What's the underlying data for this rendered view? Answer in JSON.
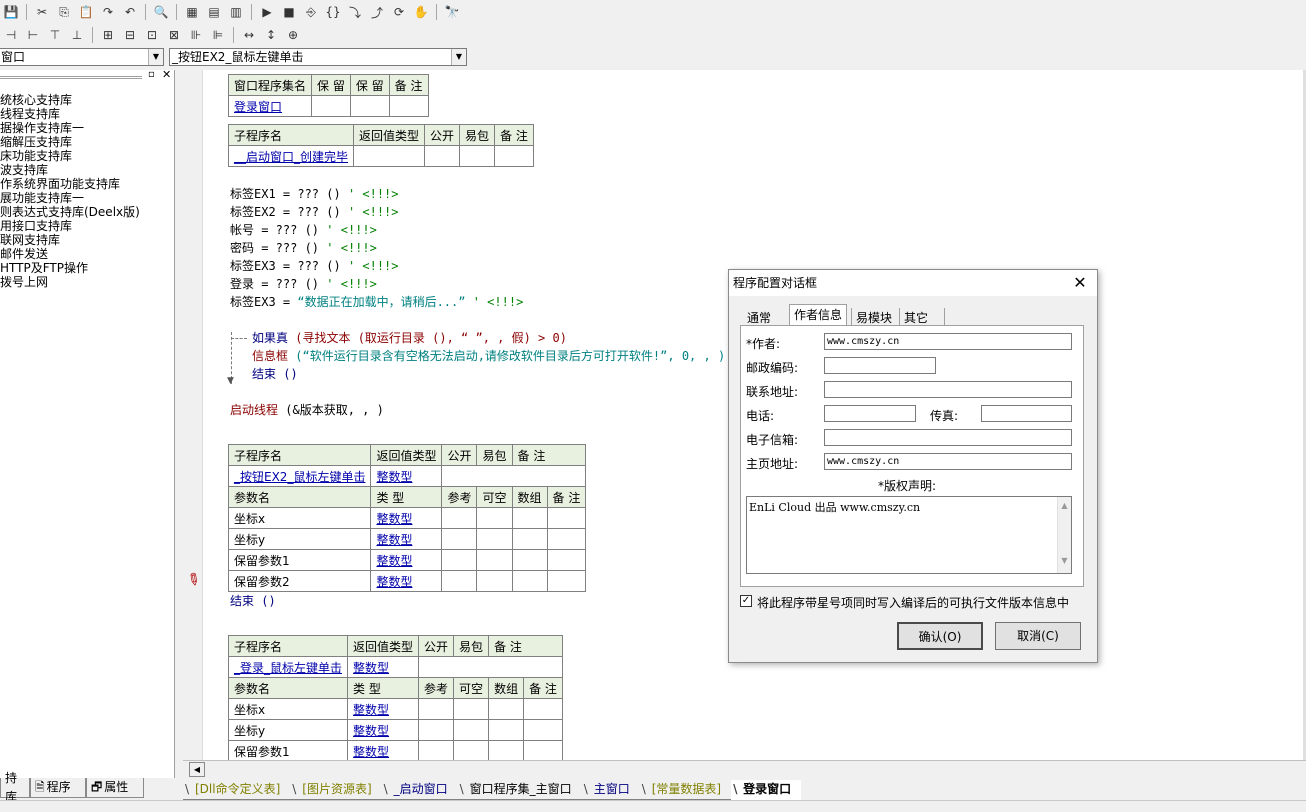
{
  "toolbar1": [
    {
      "name": "save-icon",
      "glyph": "💾"
    },
    {
      "name": "cut-icon",
      "glyph": "✂"
    },
    {
      "name": "copy-icon",
      "glyph": "⎘"
    },
    {
      "name": "paste-icon",
      "glyph": "📋"
    },
    {
      "name": "redo-icon",
      "glyph": "↷"
    },
    {
      "name": "undo-icon",
      "glyph": "↶"
    },
    {
      "name": "find-icon",
      "glyph": "🔍"
    },
    {
      "name": "layout1-icon",
      "glyph": "▦"
    },
    {
      "name": "layout2-icon",
      "glyph": "▤"
    },
    {
      "name": "layout3-icon",
      "glyph": "▥"
    },
    {
      "name": "run-icon",
      "glyph": "▶"
    },
    {
      "name": "stop-icon",
      "glyph": "■"
    },
    {
      "name": "step1-icon",
      "glyph": "⎆"
    },
    {
      "name": "step2-icon",
      "glyph": "{}"
    },
    {
      "name": "step3-icon",
      "glyph": "⤵"
    },
    {
      "name": "step4-icon",
      "glyph": "⤴"
    },
    {
      "name": "step5-icon",
      "glyph": "⟳"
    },
    {
      "name": "hand-icon",
      "glyph": "✋"
    },
    {
      "name": "binoculars-icon",
      "glyph": "🔭"
    }
  ],
  "toolbar2": [
    {
      "name": "align1-icon",
      "glyph": "⊣"
    },
    {
      "name": "align2-icon",
      "glyph": "⊢"
    },
    {
      "name": "align3-icon",
      "glyph": "⊤"
    },
    {
      "name": "align4-icon",
      "glyph": "⊥"
    },
    {
      "name": "align5-icon",
      "glyph": "⊞"
    },
    {
      "name": "align6-icon",
      "glyph": "⊟"
    },
    {
      "name": "align7-icon",
      "glyph": "⊡"
    },
    {
      "name": "align8-icon",
      "glyph": "⊠"
    },
    {
      "name": "align9-icon",
      "glyph": "⊪"
    },
    {
      "name": "align10-icon",
      "glyph": "⊫"
    },
    {
      "name": "size1-icon",
      "glyph": "↔"
    },
    {
      "name": "size2-icon",
      "glyph": "↕"
    },
    {
      "name": "size3-icon",
      "glyph": "⊕"
    }
  ],
  "combo_left": "窗口",
  "combo_right": "_按钮EX2_鼠标左键单击",
  "libraries": [
    "统核心支持库",
    "线程支持库",
    "据操作支持库一",
    "缩解压支持库",
    "床功能支持库",
    "波支持库",
    "作系统界面功能支持库",
    "展功能支持库一",
    "则表达式支持库(Deelx版)",
    "用接口支持库",
    "联网支持库",
    "  邮件发送",
    "  HTTP及FTP操作",
    "  拨号上网"
  ],
  "left_tabs": {
    "lib": "持库",
    "program": "程序",
    "props": "属性"
  },
  "table_set": {
    "headers": [
      "窗口程序集名",
      "保 留",
      "保 留",
      "备 注"
    ],
    "row": [
      "登录窗口",
      "",
      "",
      ""
    ]
  },
  "table_sub1": {
    "headers": [
      "子程序名",
      "返回值类型",
      "公开",
      "易包",
      "备 注"
    ],
    "row": [
      "__启动窗口_创建完毕",
      "",
      "",
      "",
      ""
    ]
  },
  "code1": [
    {
      "lhs": "标签EX1 = ??? ()",
      "cm": "' <!!!>"
    },
    {
      "lhs": "标签EX2 = ??? ()",
      "cm": "' <!!!>"
    },
    {
      "lhs": "帐号 = ??? ()",
      "cm": "' <!!!>"
    },
    {
      "lhs": "密码 = ??? ()",
      "cm": "' <!!!>"
    },
    {
      "lhs": "标签EX3 = ??? ()",
      "cm": "' <!!!>"
    },
    {
      "lhs": "登录 = ??? ()",
      "cm": "' <!!!>"
    }
  ],
  "code1_last": {
    "lhs": "标签EX3 = ",
    "str": "“数据正在加载中，请稍后...”",
    "cm": "' <!!!>"
  },
  "if_line": {
    "kw": "如果真",
    "rest": " (寻找文本 (取运行目录 (), “ ”, , 假) > 0)"
  },
  "msg_line": {
    "kw": "信息框",
    "str": " (“软件运行目录含有空格无法启动,请修改软件目录后方可打开软件!”, 0, , )"
  },
  "end_line1": "结束 ()",
  "thread_line": {
    "kw": "启动线程",
    "rest": " (&版本获取, , )"
  },
  "table_sub2": {
    "headers": [
      "子程序名",
      "返回值类型",
      "公开",
      "易包",
      "备 注"
    ],
    "row": [
      "_按钮EX2_鼠标左键单击",
      "整数型"
    ],
    "param_headers": [
      "参数名",
      "类 型",
      "参考",
      "可空",
      "数组",
      "备 注"
    ],
    "params": [
      [
        "坐标x",
        "整数型"
      ],
      [
        "坐标y",
        "整数型"
      ],
      [
        "保留参数1",
        "整数型"
      ],
      [
        "保留参数2",
        "整数型"
      ]
    ]
  },
  "end_line2": "结束 ()",
  "table_sub3": {
    "headers": [
      "子程序名",
      "返回值类型",
      "公开",
      "易包",
      "备 注"
    ],
    "row": [
      "_登录_鼠标左键单击",
      "整数型"
    ],
    "param_headers": [
      "参数名",
      "类 型",
      "参考",
      "可空",
      "数组",
      "备 注"
    ],
    "params": [
      [
        "坐标x",
        "整数型"
      ],
      [
        "坐标y",
        "整数型"
      ],
      [
        "保留参数1",
        "整数型"
      ]
    ]
  },
  "bottom_tabs": [
    {
      "label": "[Dll命令定义表]",
      "style": "olive"
    },
    {
      "label": "[图片资源表]",
      "style": "olive"
    },
    {
      "label": "_启动窗口",
      "style": "blue"
    },
    {
      "label": "窗口程序集_主窗口",
      "style": ""
    },
    {
      "label": "主窗口",
      "style": "blue"
    },
    {
      "label": "[常量数据表]",
      "style": "olive"
    },
    {
      "label": "登录窗口",
      "style": "active"
    }
  ],
  "dialog": {
    "title": "程序配置对话框",
    "tabs": [
      "通常",
      "作者信息",
      "易模块",
      "其它"
    ],
    "author_label": "*作者:",
    "author_value": "www.cmszy.cn",
    "zip_label": "邮政编码:",
    "address_label": "联系地址:",
    "phone_label": "电话:",
    "fax_label": "传真:",
    "email_label": "电子信箱:",
    "homepage_label": "主页地址:",
    "homepage_value": "www.cmszy.cn",
    "copyright_label": "*版权声明:",
    "copyright_value": "EnLi Cloud 出品 www.cmszy.cn",
    "checkbox_label": "将此程序带星号项同时写入编译后的可执行文件版本信息中",
    "ok": "确认(O)",
    "cancel": "取消(C)"
  }
}
